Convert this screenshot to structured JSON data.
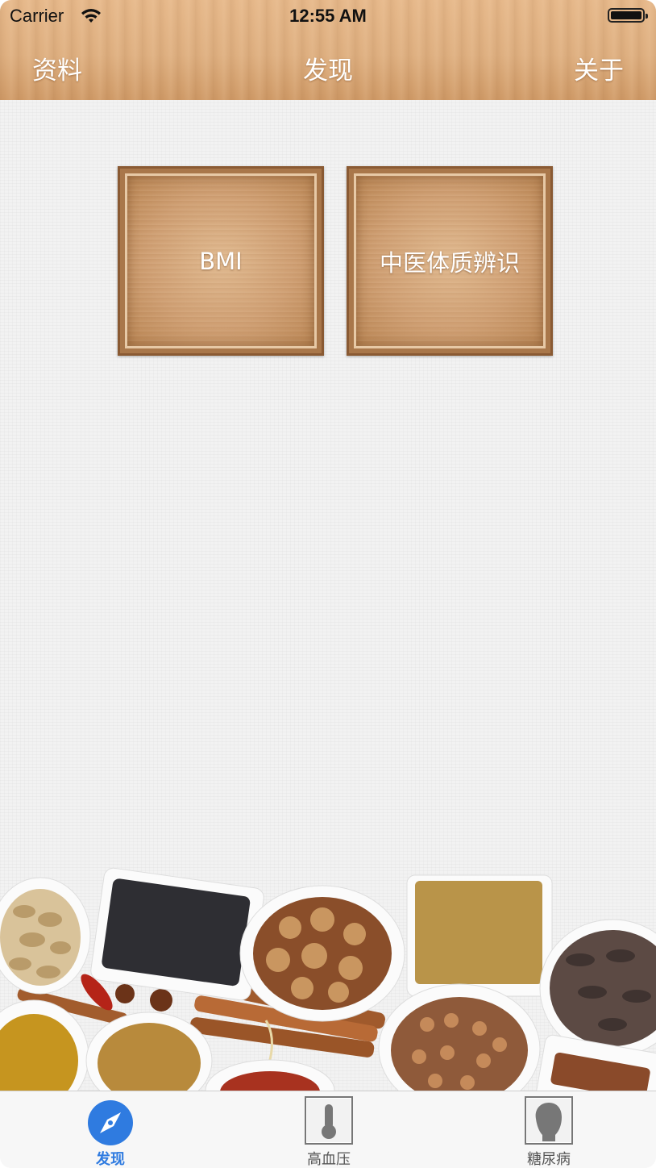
{
  "status_bar": {
    "carrier": "Carrier",
    "time": "12:55 AM",
    "battery_level": 1.0
  },
  "nav": {
    "left_label": "资料",
    "title": "发现",
    "right_label": "关于"
  },
  "tiles": [
    {
      "label": "BMI"
    },
    {
      "label": "中医体质辨识"
    }
  ],
  "tabbar": {
    "items": [
      {
        "label": "发现",
        "icon": "compass-icon",
        "active": true
      },
      {
        "label": "高血压",
        "icon": "thermometer-icon",
        "active": false
      },
      {
        "label": "糖尿病",
        "icon": "head-silhouette-icon",
        "active": false
      }
    ],
    "active_color": "#2f7be0",
    "inactive_color": "#555555"
  },
  "colors": {
    "wood_header": "#deaf80",
    "tile_frame": "#8a5a33"
  }
}
